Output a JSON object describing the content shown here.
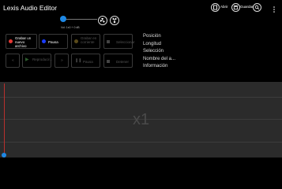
{
  "app": {
    "title": "Lexis Audio Editor"
  },
  "topbar": {
    "open_label": "Abrir",
    "save_label": "Guardar"
  },
  "scrubber": {
    "readout": "Vol: 1x0 + 0 dB"
  },
  "buttons": {
    "record_new": "Grabar un nuevo archivo",
    "pause": "Pausa",
    "record_current": "Grabar en corriente",
    "select": "Seleccionar",
    "play_selection": "Reproducir...",
    "pause2": "Pausa",
    "stop": "Detener"
  },
  "info_labels": [
    "Posición",
    "Longitud",
    "Selección",
    "Nombre del a...",
    "Información"
  ],
  "waveform": {
    "zoom_label": "x1"
  },
  "colors": {
    "accent": "#1e88e5",
    "record": "#e53935",
    "pause": "#1a3cff",
    "waveform_bg": "#2b2b2b",
    "cursor": "#b8302e"
  }
}
